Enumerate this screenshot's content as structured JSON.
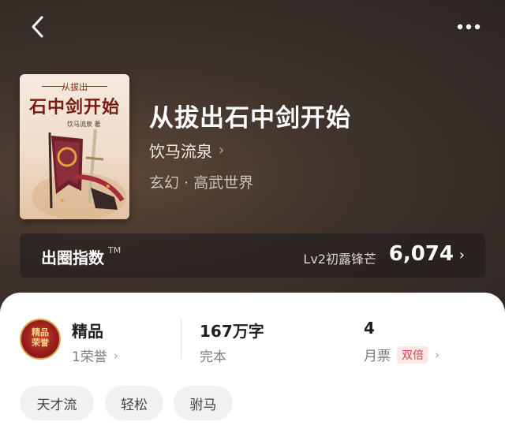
{
  "header": {
    "back_icon": "chevron-left-icon",
    "more_icon": "more-horizontal-icon"
  },
  "book": {
    "cover": {
      "small_title": "从拔出",
      "title": "石中剑开始",
      "author": "饮马流泉 著"
    },
    "title": "从拔出石中剑开始",
    "author": "饮马流泉",
    "genre": "玄幻 · 高武世界"
  },
  "index": {
    "label": "出圈指数",
    "tm": "TM",
    "level": "Lv2初露锋芒",
    "value": "6,074"
  },
  "stats": {
    "badge_text_line1": "精品",
    "badge_text_line2": "荣誉",
    "quality": {
      "title": "精品",
      "sub": "1荣誉"
    },
    "words": {
      "title": "167万字",
      "sub": "完本"
    },
    "tickets": {
      "title": "4",
      "sub": "月票",
      "tag": "双倍"
    }
  },
  "tags": [
    "天才流",
    "轻松",
    "驸马"
  ],
  "colors": {
    "accent_red": "#e0414a",
    "hero_dark": "#2b2523"
  }
}
